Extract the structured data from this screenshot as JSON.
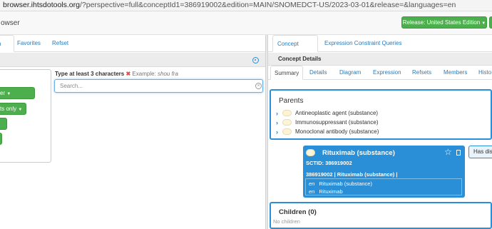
{
  "browser": {
    "url_host": "browser.ihtsdotools.org",
    "url_rest": "/?perspective=full&conceptId1=386919002&edition=MAIN/SNOMEDCT-US/2023-03-01&release=&languages=en"
  },
  "header": {
    "title": "owser",
    "release_button": "Release: United States Edition"
  },
  "left": {
    "tabs": [
      {
        "label": "h",
        "active": true
      },
      {
        "label": "Favorites",
        "active": false
      },
      {
        "label": "Refset",
        "active": false
      }
    ],
    "filter_buttons": [
      "er",
      "ts only",
      "",
      ""
    ],
    "type_hint": "Type at least 3 characters",
    "example_label": "Example:",
    "example_value": "shou fra",
    "search_placeholder": "Search..."
  },
  "right": {
    "tabs": [
      {
        "label": "Concept Details",
        "active": true
      },
      {
        "label": "Expression Constraint Queries",
        "active": false
      }
    ],
    "section_title": "Concept Details",
    "sub_tabs": [
      {
        "label": "Summary",
        "active": true
      },
      {
        "label": "Details",
        "active": false
      },
      {
        "label": "Diagram",
        "active": false
      },
      {
        "label": "Expression",
        "active": false
      },
      {
        "label": "Refsets",
        "active": false
      },
      {
        "label": "Members",
        "active": false
      },
      {
        "label": "Histo",
        "active": false
      }
    ],
    "parents": {
      "heading": "Parents",
      "items": [
        "Antineoplastic agent (substance)",
        "Immunosuppressant (substance)",
        "Monoclonal antibody (substance)"
      ]
    },
    "concept": {
      "name": "Rituximab (substance)",
      "sctid": "SCTID: 386919002",
      "fsn_line": "386919002 | Rituximab (substance) |",
      "descriptions": [
        {
          "lang": "en",
          "text": "Rituximab (substance)"
        },
        {
          "lang": "en",
          "text": "Rituximab"
        }
      ]
    },
    "has_dis_label": "Has dis",
    "children": {
      "heading": "Children (0)",
      "empty_text": "No children"
    }
  },
  "colors": {
    "accent_blue": "#2a8fd6",
    "button_green": "#4cae4c",
    "link_blue": "#2a7ab8"
  }
}
